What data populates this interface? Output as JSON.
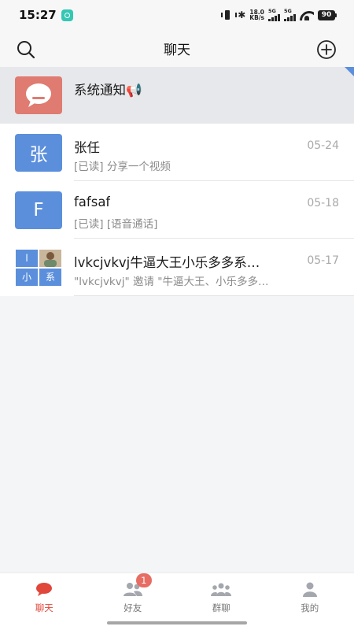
{
  "status_bar": {
    "time": "15:27",
    "net_speed_value": "18.0",
    "net_speed_unit": "KB/s",
    "sim1_label": "5G",
    "sim2_label": "5G",
    "battery": "90"
  },
  "header": {
    "title": "聊天",
    "left_icon": "search-icon",
    "right_icon": "add-circle-icon"
  },
  "chats": [
    {
      "name": "系统通知📢",
      "subtitle": "",
      "date": "",
      "avatar": "system-notice-icon"
    },
    {
      "name": "张任",
      "subtitle": "[已读] 分享一个视频",
      "date": "05-24",
      "avatar_text": "张"
    },
    {
      "name": "fafsaf",
      "subtitle": "[已读] [语音通话]",
      "date": "05-18",
      "avatar_text": "F"
    },
    {
      "name": "lvkcjvkvj牛逼大王小乐多多系…",
      "subtitle": "\"lvkcjvkvj\" 邀请 \"牛逼大王、小乐多多…",
      "date": "05-17",
      "avatar_cells": [
        "l",
        "小",
        "系"
      ]
    }
  ],
  "tabs": [
    {
      "label": "聊天",
      "icon": "chat-bubble-icon",
      "active": true
    },
    {
      "label": "好友",
      "icon": "friends-icon",
      "badge": "1"
    },
    {
      "label": "群聊",
      "icon": "group-icon"
    },
    {
      "label": "我的",
      "icon": "profile-icon"
    }
  ],
  "colors": {
    "accent": "#e0463a",
    "avatar_blue": "#5b8fdc",
    "system_avatar": "#df7b70",
    "badge": "#e76c63"
  }
}
